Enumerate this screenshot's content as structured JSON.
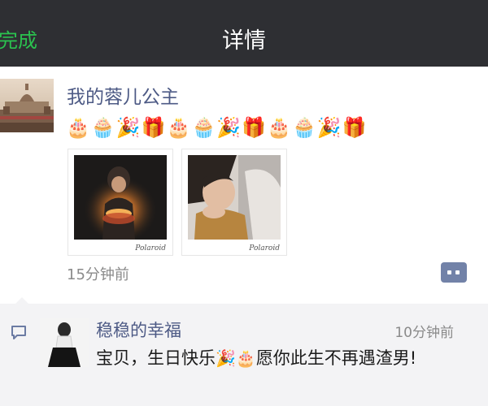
{
  "nav": {
    "back_label": "完成",
    "title": "详情"
  },
  "post": {
    "username": "我的蓉儿公主",
    "emojis": [
      {
        "char": "🎂",
        "icon": "birthday-cake-icon"
      },
      {
        "char": "🧁",
        "icon": "cupcake-icon"
      },
      {
        "char": "🎉",
        "icon": "party-popper-icon"
      },
      {
        "char": "🎁",
        "icon": "gift-icon"
      },
      {
        "char": "🎂",
        "icon": "birthday-cake-icon"
      },
      {
        "char": "🧁",
        "icon": "cupcake-icon"
      },
      {
        "char": "🎉",
        "icon": "party-popper-icon"
      },
      {
        "char": "🎁",
        "icon": "gift-icon"
      },
      {
        "char": "🎂",
        "icon": "birthday-cake-icon"
      },
      {
        "char": "🧁",
        "icon": "cupcake-icon"
      },
      {
        "char": "🎉",
        "icon": "party-popper-icon"
      },
      {
        "char": "🎁",
        "icon": "gift-icon"
      }
    ],
    "photos": [
      {
        "subject": "girl-with-birthday-candles",
        "signature": "Polaroid"
      },
      {
        "subject": "girl-resting-chin-on-hands",
        "signature": "Polaroid"
      }
    ],
    "timestamp": "15分钟前",
    "comment_icon": "comment-dots-icon"
  },
  "comment": {
    "username": "稳稳的幸福",
    "time": "10分钟前",
    "text_part1": "宝贝，生日快乐",
    "emoji1": "🎉",
    "emoji2": "🎂",
    "text_part2": "愿你此生不再遇渣男!"
  },
  "colors": {
    "navbar_bg": "#2e2f33",
    "back_green": "#2bc24f",
    "name_blue": "#4d5a85",
    "timestamp_gray": "#8a8a8a",
    "comment_bg": "#f3f3f5"
  }
}
